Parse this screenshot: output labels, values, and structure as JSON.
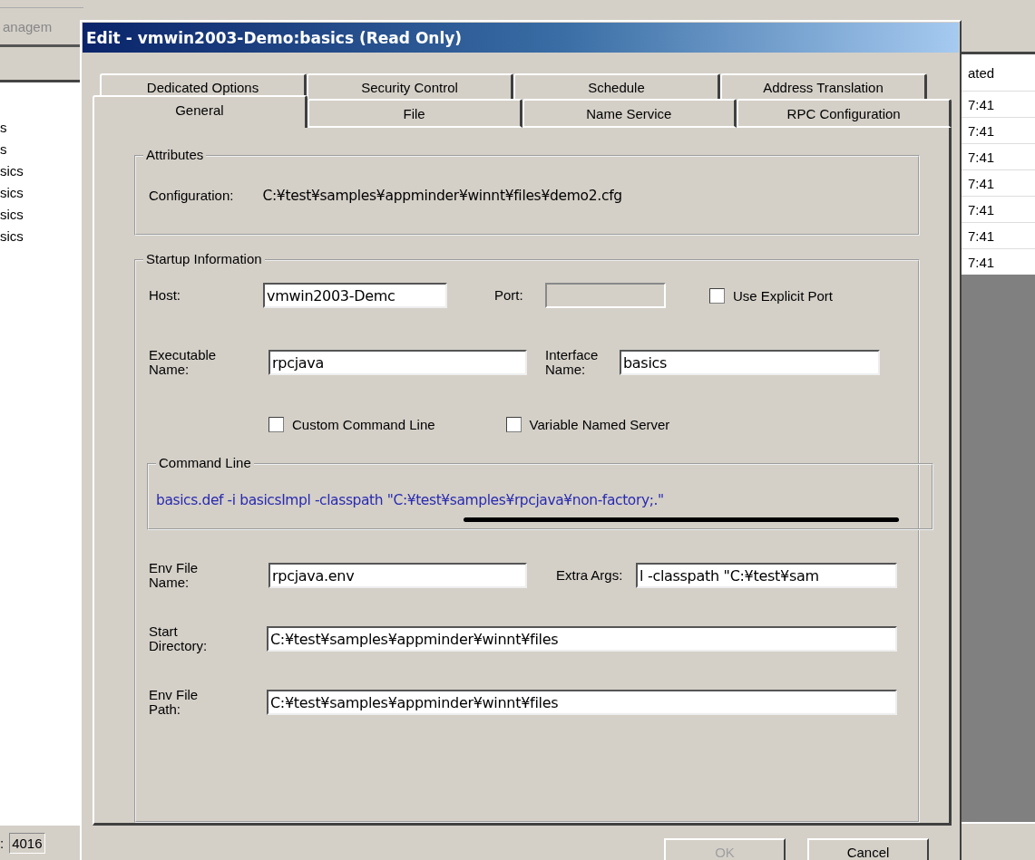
{
  "background_app": {
    "title": "anagem",
    "list_items": [
      "s",
      "s",
      "sics",
      "sics",
      "sics",
      "sics"
    ],
    "column_header": "ated",
    "column_cells": [
      "7:41",
      "7:41",
      "7:41",
      "7:41",
      "7:41",
      "7:41",
      "7:41"
    ],
    "status_label": ":",
    "status_value": "4016"
  },
  "dialog": {
    "title": "Edit - vmwin2003-Demo:basics (Read Only)",
    "tab_rows": [
      [
        {
          "label": "Dedicated Options",
          "selected": false
        },
        {
          "label": "Security Control",
          "selected": false
        },
        {
          "label": "Schedule",
          "selected": false
        },
        {
          "label": "Address Translation",
          "selected": false
        }
      ],
      [
        {
          "label": "General",
          "selected": true
        },
        {
          "label": "File",
          "selected": false
        },
        {
          "label": "Name Service",
          "selected": false
        },
        {
          "label": "RPC Configuration",
          "selected": false
        }
      ]
    ],
    "attributes": {
      "title": "Attributes",
      "configuration_label": "Configuration:",
      "configuration_value": "C:¥test¥samples¥appminder¥winnt¥files¥demo2.cfg"
    },
    "startup": {
      "title": "Startup Information",
      "host": {
        "label": "Host:",
        "value": "vmwin2003-Demc"
      },
      "port": {
        "label": "Port:",
        "disabled": true
      },
      "use_explicit_port": {
        "label": "Use Explicit Port",
        "checked": false
      },
      "executable_name": {
        "label": "Executable Name:",
        "value": "rpcjava"
      },
      "interface_name": {
        "label": "Interface Name:",
        "value": "basics"
      },
      "custom_command_line": {
        "label": "Custom Command Line",
        "checked": false
      },
      "variable_named_server": {
        "label": "Variable Named Server",
        "checked": false
      },
      "command_line": {
        "title": "Command Line",
        "text": "basics.def -i basicsImpl -classpath \"C:¥test¥samples¥rpcjava¥non-factory;.\""
      },
      "env_file_name": {
        "label": "Env File Name:",
        "value": "rpcjava.env"
      },
      "extra_args": {
        "label": "Extra Args:",
        "value": "l -classpath \"C:¥test¥sam"
      },
      "start_directory": {
        "label": "Start Directory:",
        "value": "C:¥test¥samples¥appminder¥winnt¥files"
      },
      "env_file_path": {
        "label": "Env File Path:",
        "value": "C:¥test¥samples¥appminder¥winnt¥files"
      }
    },
    "buttons": [
      {
        "label": "OK",
        "disabled": true
      },
      {
        "label": "Cancel",
        "disabled": false
      }
    ]
  }
}
